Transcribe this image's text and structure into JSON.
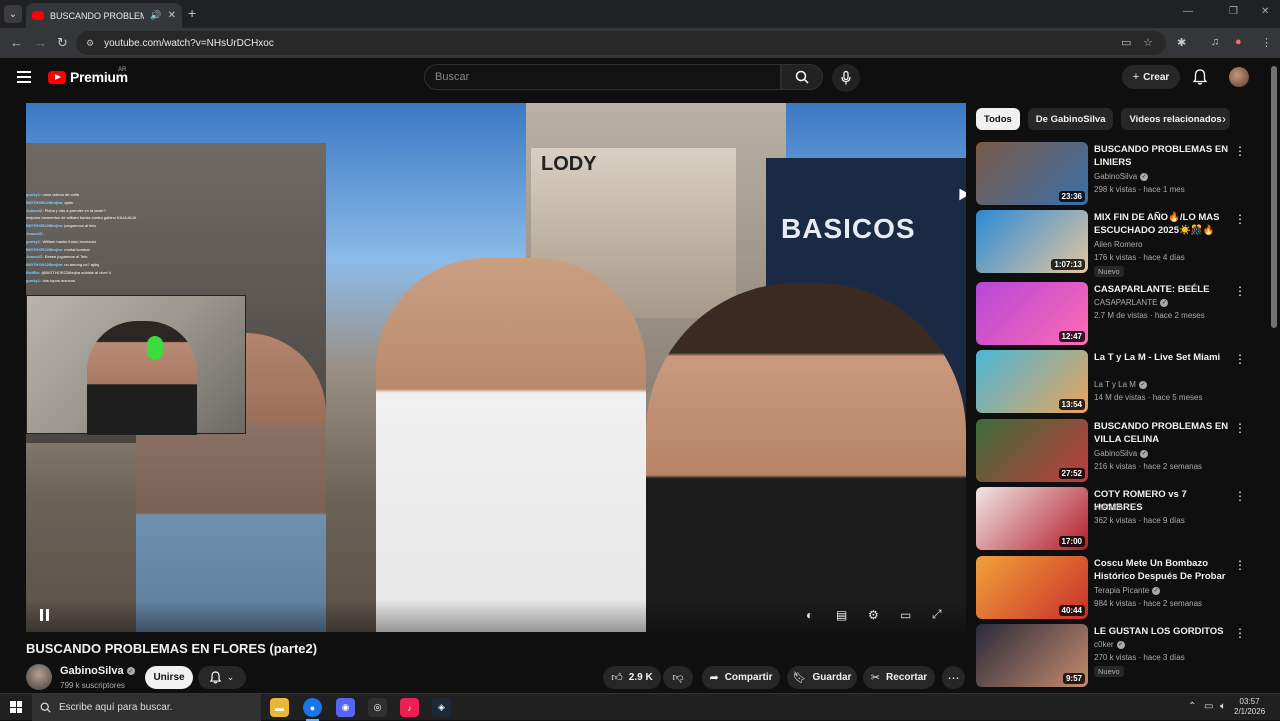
{
  "browser": {
    "tab_title": "BUSCANDO PROBLEMAS EN FLORES (parte2)",
    "url": "youtube.com/watch?v=NHsUrDCHxoc"
  },
  "header": {
    "logo_text": "Premium",
    "logo_region": "AR",
    "search_placeholder": "Buscar",
    "create_label": "Crear"
  },
  "player": {
    "sign_text": "BASICOS",
    "billboard_text": "LODY",
    "chat_lines": [
      {
        "user": "gunky1:",
        "text": "unos videos de cofla"
      },
      {
        "user": "BIGTHOR228bnjha:",
        "text": "ojala"
      },
      {
        "user": "Joaco4Z:",
        "text": "Picha y vas a prender en la tarde?"
      },
      {
        "user": "",
        "text": "mejores momentos de william banks contra gabino KAJAJAJA"
      },
      {
        "user": "BIGTHOR228bnjha:",
        "text": "jueguemos al teto"
      },
      {
        "user": "Joaco4Z:",
        "text": ""
      },
      {
        "user": "gunky1:",
        "text": "William banks futuro boxeador"
      },
      {
        "user": "BIGTHOR228bnjha:",
        "text": "mortal kombat"
      },
      {
        "user": "Joaco4Z:",
        "text": "Eeeee juguemos al Teto"
      },
      {
        "user": "BIGTHOR228bnjha:",
        "text": "un among us? ajdsj"
      },
      {
        "user": "BotRix:",
        "text": "@BIGTHOR228bnjha subiste al nivel 4"
      },
      {
        "user": "gunky1:",
        "text": "dos topos mancos"
      }
    ]
  },
  "video": {
    "title": "BUSCANDO PROBLEMAS EN FLORES (parte2)",
    "channel": "GabinoSilva",
    "subscribers": "799 k suscriptores",
    "join_label": "Unirse",
    "likes": "2.9 K",
    "share_label": "Compartir",
    "save_label": "Guardar",
    "clip_label": "Recortar"
  },
  "sidebar": {
    "chips": [
      "Todos",
      "De GabinoSilva",
      "Videos relacionados"
    ],
    "recommendations": [
      {
        "title": "BUSCANDO PROBLEMAS EN LINIERS",
        "channel": "GabinoSilva",
        "verified": true,
        "meta": "298 k vistas · hace 1 mes",
        "duration": "23:36",
        "badge": "",
        "thumb_a": "#7a5a48",
        "thumb_b": "#3b6fa8"
      },
      {
        "title": "MIX FIN DE AÑO🔥/LO MAS ESCUCHADO 2025☀️🎊🔥 (tu...",
        "channel": "Ailen Romero",
        "verified": false,
        "meta": "176 k vistas · hace 4 días",
        "duration": "1:07:13",
        "badge": "Nuevo",
        "thumb_a": "#2a8ad6",
        "thumb_b": "#e6c6a0"
      },
      {
        "title": "CASAPARLANTE: BEÉLE",
        "channel": "CASAPARLANTE",
        "verified": true,
        "meta": "2.7 M de vistas · hace 2 meses",
        "duration": "12:47",
        "badge": "",
        "thumb_a": "#b548d8",
        "thumb_b": "#ff6ab3"
      },
      {
        "title": "La T y La M - Live Set Miami",
        "channel": "La T y La M",
        "verified": true,
        "meta": "14 M de vistas · hace 5 meses",
        "duration": "13:54",
        "badge": "",
        "thumb_a": "#49b7d8",
        "thumb_b": "#e8a45a"
      },
      {
        "title": "BUSCANDO PROBLEMAS EN VILLA CELINA",
        "channel": "GabinoSilva",
        "verified": true,
        "meta": "216 k vistas · hace 2 semanas",
        "duration": "27:52",
        "badge": "",
        "thumb_a": "#3a6d3a",
        "thumb_b": "#c23b3b"
      },
      {
        "title": "COTY ROMERO vs 7 HOMBRES",
        "channel": "WANDII",
        "verified": false,
        "meta": "362 k vistas · hace 9 días",
        "duration": "17:00",
        "badge": "",
        "thumb_a": "#f0e6e6",
        "thumb_b": "#b31c2a"
      },
      {
        "title": "Coscu Mete Un Bombazo Histórico Después De Probar ...",
        "channel": "Terapia Picante",
        "verified": true,
        "meta": "984 k vistas · hace 2 semanas",
        "duration": "40:44",
        "badge": "",
        "thumb_a": "#f2a13a",
        "thumb_b": "#c8302a"
      },
      {
        "title": "LE GUSTAN LOS GORDITOS",
        "channel": "c0ker",
        "verified": true,
        "meta": "270 k vistas · hace 3 días",
        "duration": "9:57",
        "badge": "Nuevo",
        "thumb_a": "#2a2a3a",
        "thumb_b": "#c68b6e"
      }
    ]
  },
  "taskbar": {
    "search_placeholder": "Escribe aquí para buscar.",
    "time": "03:57",
    "date": "2/1/2026"
  }
}
